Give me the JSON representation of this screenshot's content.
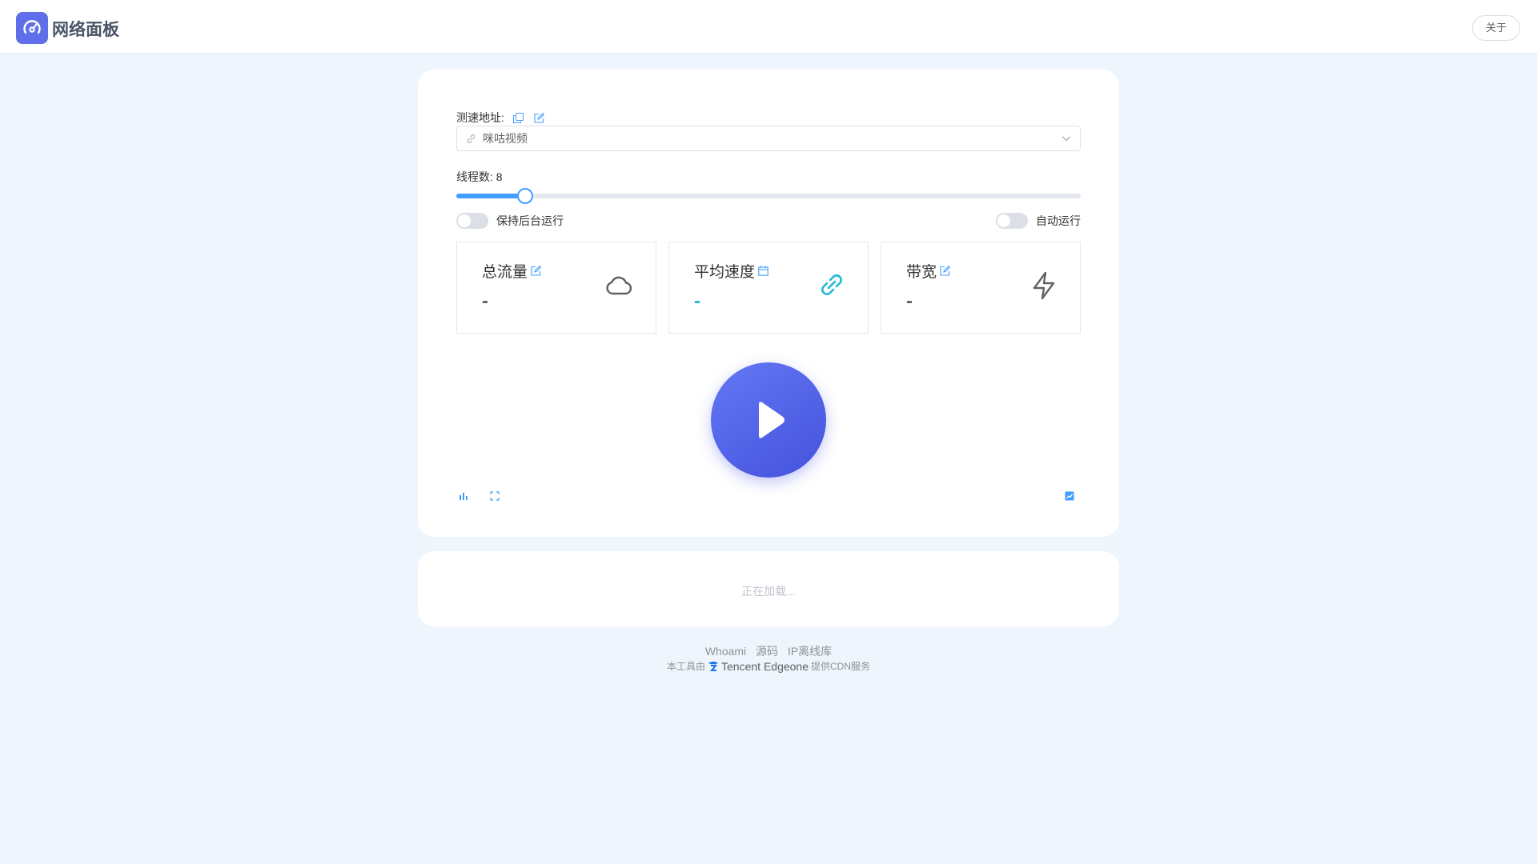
{
  "header": {
    "app_title": "网络面板",
    "about_label": "关于",
    "logo_icon": "speedometer-icon"
  },
  "speed_test": {
    "url_label": "测速地址:",
    "selected_source": "咪咕视频",
    "threads_label": "线程数:",
    "threads_value": "8",
    "threads_slider": {
      "value": 8,
      "fraction": 0.11
    },
    "keep_background_label": "保持后台运行",
    "auto_run_label": "自动运行",
    "keep_background_on": false,
    "auto_run_on": false
  },
  "stats": [
    {
      "title": "总流量",
      "value": "-",
      "icon": "cloud-icon"
    },
    {
      "title": "平均速度",
      "value": "-",
      "icon": "link-icon"
    },
    {
      "title": "带宽",
      "value": "-",
      "icon": "lightning-icon"
    }
  ],
  "loading": {
    "text": "正在加载..."
  },
  "footer": {
    "links": [
      "Whoami",
      "源码",
      "IP离线库"
    ],
    "credit_prefix": "本工具由",
    "credit_brand": "Tencent Edgeone",
    "credit_suffix": "提供CDN服务"
  },
  "colors": {
    "accent": "#409eff",
    "brand": "#5f6fea",
    "cyan": "#1fb8d6",
    "background": "#eef5fd"
  }
}
